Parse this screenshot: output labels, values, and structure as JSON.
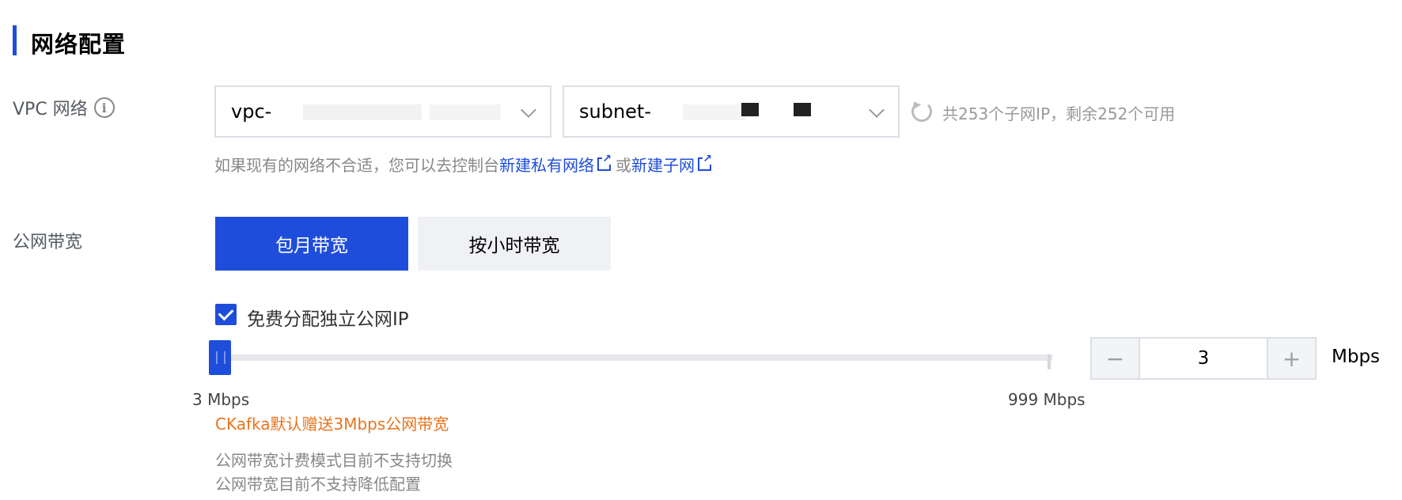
{
  "section": {
    "title": "网络配置"
  },
  "vpc": {
    "label": "VPC 网络",
    "vpc_select_value": "vpc-",
    "subnet_select_value": "subnet-",
    "ip_info": "共253个子网IP，剩余252个可用",
    "hint_prefix": "如果现有的网络不合适，您可以去控制台",
    "link_new_vpc": "新建私有网络",
    "hint_or": "或",
    "link_new_subnet": "新建子网"
  },
  "bandwidth": {
    "label": "公网带宽",
    "options": [
      {
        "label": "包月带宽",
        "selected": true
      },
      {
        "label": "按小时带宽",
        "selected": false
      }
    ],
    "free_ip_checkbox_label": "免费分配独立公网IP",
    "free_ip_checked": true,
    "slider": {
      "min_label": "3 Mbps",
      "max_label": "999 Mbps",
      "min": 3,
      "max": 999,
      "value": 3
    },
    "stepper": {
      "minus": "−",
      "value": "3",
      "plus": "+",
      "unit": "Mbps"
    },
    "note_promo": "CKafka默认赠送3Mbps公网带宽",
    "note_billing": "公网带宽计费模式目前不支持切换",
    "note_downgrade": "公网带宽目前不支持降低配置"
  },
  "colors": {
    "primary": "#1f4ddb",
    "promo": "#e8741c",
    "muted": "#888888"
  }
}
